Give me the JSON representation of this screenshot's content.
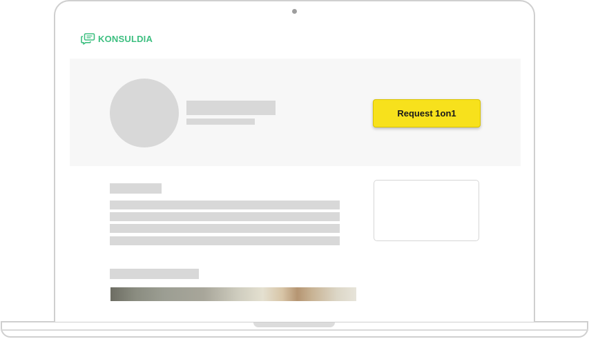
{
  "brand": {
    "name": "KONSULDIA",
    "color": "#3dbf80"
  },
  "hero": {
    "request_button_label": "Request 1on1",
    "button_color": "#f7e11c"
  },
  "icons": {
    "logo_icon": "chat-bubbles-icon"
  }
}
